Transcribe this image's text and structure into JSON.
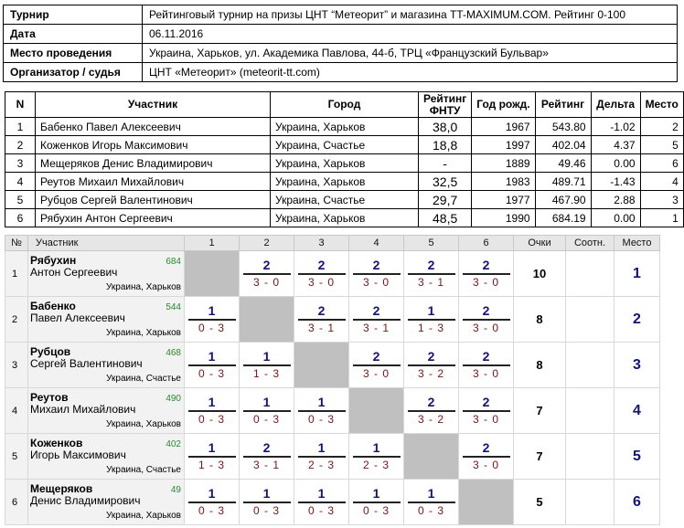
{
  "info": [
    {
      "label": "Турнир",
      "value": "Рейтинговый турнир на призы ЦНТ “Метеорит” и магазина TT-MAXIMUM.COM. Рейтинг 0-100"
    },
    {
      "label": "Дата",
      "value": "06.11.2016"
    },
    {
      "label": "Место проведения",
      "value": "Украина, Харьков, ул. Академика Павлова, 44-б, ТРЦ «Французский Бульвар»"
    },
    {
      "label": "Организатор / судья",
      "value": "ЦНТ «Метеорит» (meteorit-tt.com)"
    }
  ],
  "participants": {
    "headers": {
      "n": "N",
      "name": "Участник",
      "city": "Город",
      "fntu_1": "Рейтинг",
      "fntu_2": "ФНТУ",
      "year": "Год рожд.",
      "rating": "Рейтинг",
      "delta": "Дельта",
      "place": "Место"
    },
    "rows": [
      {
        "n": "1",
        "name": "Бабенко Павел Алексеевич",
        "city": "Украина, Харьков",
        "fntu": "38,0",
        "year": "1967",
        "rating": "543.80",
        "delta": "-1.02",
        "place": "2"
      },
      {
        "n": "2",
        "name": "Коженков Игорь Максимович",
        "city": "Украина, Счастье",
        "fntu": "18,8",
        "year": "1997",
        "rating": "402.04",
        "delta": "4.37",
        "place": "5"
      },
      {
        "n": "3",
        "name": "Мещеряков Денис Владимирович",
        "city": "Украина, Харьков",
        "fntu": "-",
        "year": "1889",
        "rating": "49.46",
        "delta": "0.00",
        "place": "6"
      },
      {
        "n": "4",
        "name": "Реутов Михаил Михайлович",
        "city": "Украина, Харьков",
        "fntu": "32,5",
        "year": "1983",
        "rating": "489.71",
        "delta": "-1.43",
        "place": "4"
      },
      {
        "n": "5",
        "name": "Рубцов Сергей Валентинович",
        "city": "Украина, Счастье",
        "fntu": "29,7",
        "year": "1977",
        "rating": "467.90",
        "delta": "2.88",
        "place": "3"
      },
      {
        "n": "6",
        "name": "Рябухин Антон Сергеевич",
        "city": "Украина, Харьков",
        "fntu": "48,5",
        "year": "1990",
        "rating": "684.19",
        "delta": "0.00",
        "place": "1"
      }
    ]
  },
  "cross": {
    "headers": {
      "no": "№",
      "name": "Участник",
      "cols": [
        "1",
        "2",
        "3",
        "4",
        "5",
        "6"
      ],
      "points": "Очки",
      "ratio": "Соотн.",
      "place": "Место"
    },
    "rows": [
      {
        "no": "1",
        "last": "Рябухин",
        "first": "Антон Сергеевич",
        "rating": "684",
        "city": "Украина, Харьков",
        "games": [
          null,
          {
            "p": "2",
            "s": "3 - 0"
          },
          {
            "p": "2",
            "s": "3 - 0"
          },
          {
            "p": "2",
            "s": "3 - 0"
          },
          {
            "p": "2",
            "s": "3 - 1"
          },
          {
            "p": "2",
            "s": "3 - 0"
          }
        ],
        "points": "10",
        "ratio": "",
        "place": "1"
      },
      {
        "no": "2",
        "last": "Бабенко",
        "first": "Павел Алексеевич",
        "rating": "544",
        "city": "Украина, Харьков",
        "games": [
          {
            "p": "1",
            "s": "0 - 3"
          },
          null,
          {
            "p": "2",
            "s": "3 - 1"
          },
          {
            "p": "2",
            "s": "3 - 1"
          },
          {
            "p": "1",
            "s": "1 - 3"
          },
          {
            "p": "2",
            "s": "3 - 0"
          }
        ],
        "points": "8",
        "ratio": "",
        "place": "2"
      },
      {
        "no": "3",
        "last": "Рубцов",
        "first": "Сергей Валентинович",
        "rating": "468",
        "city": "Украина, Счастье",
        "games": [
          {
            "p": "1",
            "s": "0 - 3"
          },
          {
            "p": "1",
            "s": "1 - 3"
          },
          null,
          {
            "p": "2",
            "s": "3 - 0"
          },
          {
            "p": "2",
            "s": "3 - 2"
          },
          {
            "p": "2",
            "s": "3 - 0"
          }
        ],
        "points": "8",
        "ratio": "",
        "place": "3"
      },
      {
        "no": "4",
        "last": "Реутов",
        "first": "Михаил Михайлович",
        "rating": "490",
        "city": "Украина, Харьков",
        "games": [
          {
            "p": "1",
            "s": "0 - 3"
          },
          {
            "p": "1",
            "s": "0 - 3"
          },
          {
            "p": "1",
            "s": "0 - 3"
          },
          null,
          {
            "p": "2",
            "s": "3 - 2"
          },
          {
            "p": "2",
            "s": "3 - 0"
          }
        ],
        "points": "7",
        "ratio": "",
        "place": "4"
      },
      {
        "no": "5",
        "last": "Коженков",
        "first": "Игорь Максимович",
        "rating": "402",
        "city": "Украина, Счастье",
        "games": [
          {
            "p": "1",
            "s": "1 - 3"
          },
          {
            "p": "2",
            "s": "3 - 1"
          },
          {
            "p": "1",
            "s": "2 - 3"
          },
          {
            "p": "1",
            "s": "2 - 3"
          },
          null,
          {
            "p": "2",
            "s": "3 - 0"
          }
        ],
        "points": "7",
        "ratio": "",
        "place": "5"
      },
      {
        "no": "6",
        "last": "Мещеряков",
        "first": "Денис Владимирович",
        "rating": "49",
        "city": "Украина, Харьков",
        "games": [
          {
            "p": "1",
            "s": "0 - 3"
          },
          {
            "p": "1",
            "s": "0 - 3"
          },
          {
            "p": "1",
            "s": "0 - 3"
          },
          {
            "p": "1",
            "s": "0 - 3"
          },
          {
            "p": "1",
            "s": "0 - 3"
          },
          null
        ],
        "points": "5",
        "ratio": "",
        "place": "6"
      }
    ]
  }
}
